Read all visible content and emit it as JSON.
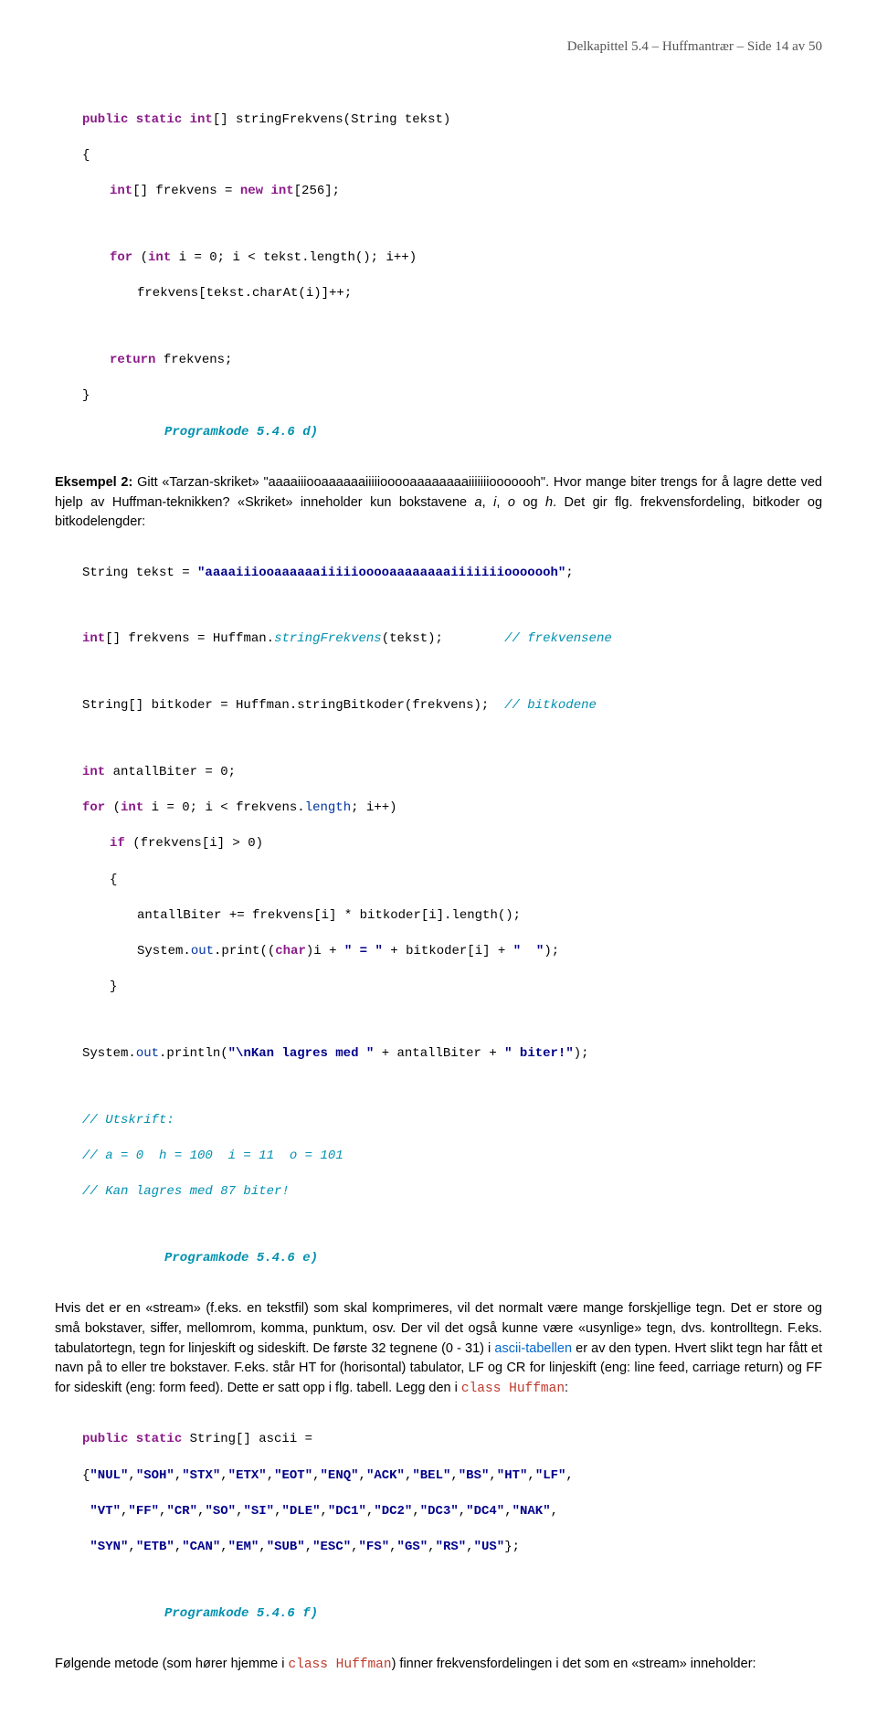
{
  "header": {
    "text": "Delkapittel 5.4 – Huffmantrær  –   Side 14 av 50"
  },
  "code_d": {
    "l1a": "public static ",
    "l1b": "int",
    "l1c": "[] stringFrekvens(String tekst)",
    "l2": "{",
    "l3a": "int",
    "l3b": "[] frekvens = ",
    "l3c": "new int",
    "l3d": "[256];",
    "l4a": "for",
    "l4b": " (",
    "l4c": "int",
    "l4d": " i = 0; i < tekst.length(); i++)",
    "l5": "frekvens[tekst.charAt(i)]++;",
    "l6a": "return",
    "l6b": " frekvens;",
    "l7": "}",
    "caption": "Programkode 5.4.6 d)"
  },
  "para1": {
    "lead": "Eksempel 2:",
    "t1": " Gitt «Tarzan-skriket» \"aaaaiiiooaaaaaaiiiiiooooaaaaaaaaiiiiiiiooooooh\". Hvor mange biter trengs for å lagre dette ved hjelp av Huffman-teknikken? «Skriket» inneholder kun bokstavene ",
    "a": "a",
    "c1": ", ",
    "i": "i",
    "c2": ", ",
    "o": "o",
    "c3": " og ",
    "h": "h",
    "t2": ". Det gir flg. frekvensfordeling, bitkoder og bitkodelengder:"
  },
  "code_e": {
    "l1a": "String tekst = ",
    "l1b": "\"aaaaiiiooaaaaaaiiiiiooooaaaaaaaaiiiiiiiooooooh\"",
    "l1c": ";",
    "l2a": "int",
    "l2b": "[] frekvens = Huffman.",
    "l2c": "stringFrekvens",
    "l2d": "(tekst);",
    "l2e": "// frekvensene",
    "l3a": "String[] bitkoder = Huffman.stringBitkoder(frekvens);  ",
    "l3b": "// bitkodene",
    "l4a": "int",
    "l4b": " antallBiter = 0;",
    "l5a": "for",
    "l5b": " (",
    "l5c": "int",
    "l5d": " i = 0; i < frekvens.",
    "l5e": "length",
    "l5f": "; i++)",
    "l6a": "if",
    "l6b": " (frekvens[i] > 0)",
    "l7": "{",
    "l8": "antallBiter += frekvens[i] * bitkoder[i].length();",
    "l9a": "System.",
    "l9b": "out",
    "l9c": ".print((",
    "l9d": "char",
    "l9e": ")i + ",
    "l9f": "\" = \"",
    "l9g": " + bitkoder[i] + ",
    "l9h": "\"  \"",
    "l9i": ");",
    "l10": "}",
    "l11a": "System.",
    "l11b": "out",
    "l11c": ".println(",
    "l11d": "\"\\nKan lagres med \"",
    "l11e": " + antallBiter + ",
    "l11f": "\" biter!\"",
    "l11g": ");",
    "c1": "// Utskrift:",
    "c2": "// a = 0  h = 100  i = 11  o = 101",
    "c3": "// Kan lagres med 87 biter!",
    "caption": "Programkode 5.4.6 e)"
  },
  "para2": {
    "t1": "Hvis det er en «stream» (f.eks. en tekstfil) som skal komprimeres, vil det normalt være mange forskjellige tegn. Det er store og små bokstaver, siffer, mellomrom, komma, punktum, osv. Der vil det også kunne være «usynlige» tegn, dvs. kontrolltegn. F.eks. tabulatortegn, tegn for linjeskift og sideskift. De første 32 tegnene (0 - 31) i ",
    "link": "ascii-tabellen",
    "t2": " er av den typen. Hvert slikt tegn har fått et navn på to eller tre bokstaver. F.eks. står HT for (horisontal) tabulator, LF og CR for linjeskift (eng: line feed, carriage return) og FF for sideskift (eng: form feed). Dette er satt opp i flg. tabell. Legg den i ",
    "classref": "class Huffman",
    "t3": ":"
  },
  "code_f": {
    "l1a": "public static",
    "l1b": " String[] ascii =",
    "l2a": "{",
    "l2b": "\"NUL\"",
    "l2c": ",",
    "l2d": "\"SOH\"",
    "l2e": ",",
    "l2f": "\"STX\"",
    "l2g": ",",
    "l2h": "\"ETX\"",
    "l2i": ",",
    "l2j": "\"EOT\"",
    "l2k": ",",
    "l2l": "\"ENQ\"",
    "l2m": ",",
    "l2n": "\"ACK\"",
    "l2o": ",",
    "l2p": "\"BEL\"",
    "l2q": ",",
    "l2r": "\"BS\"",
    "l2s": ",",
    "l2t": "\"HT\"",
    "l2u": ",",
    "l2v": "\"LF\"",
    "l2w": ",",
    "l3a": " ",
    "l3b": "\"VT\"",
    "l3c": ",",
    "l3d": "\"FF\"",
    "l3e": ",",
    "l3f": "\"CR\"",
    "l3g": ",",
    "l3h": "\"SO\"",
    "l3i": ",",
    "l3j": "\"SI\"",
    "l3k": ",",
    "l3l": "\"DLE\"",
    "l3m": ",",
    "l3n": "\"DC1\"",
    "l3o": ",",
    "l3p": "\"DC2\"",
    "l3q": ",",
    "l3r": "\"DC3\"",
    "l3s": ",",
    "l3t": "\"DC4\"",
    "l3u": ",",
    "l3v": "\"NAK\"",
    "l3w": ",",
    "l4a": " ",
    "l4b": "\"SYN\"",
    "l4c": ",",
    "l4d": "\"ETB\"",
    "l4e": ",",
    "l4f": "\"CAN\"",
    "l4g": ",",
    "l4h": "\"EM\"",
    "l4i": ",",
    "l4j": "\"SUB\"",
    "l4k": ",",
    "l4l": "\"ESC\"",
    "l4m": ",",
    "l4n": "\"FS\"",
    "l4o": ",",
    "l4p": "\"GS\"",
    "l4q": ",",
    "l4r": "\"RS\"",
    "l4s": ",",
    "l4t": "\"US\"",
    "l4u": "};",
    "caption": "Programkode 5.4.6 f)"
  },
  "para3": {
    "t1": "Følgende metode (som hører hjemme i ",
    "classref": "class Huffman",
    "t2": ") finner frekvensfordelingen i det som en «stream» inneholder:"
  }
}
